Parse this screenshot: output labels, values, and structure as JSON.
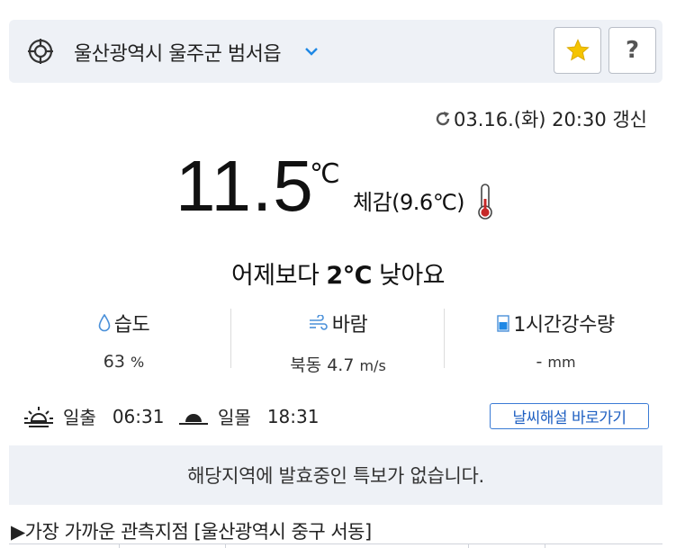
{
  "location": {
    "name": "울산광역시 울주군 범서읍",
    "locate_icon": "crosshair-icon",
    "dropdown_icon": "chevron-down-icon",
    "favorite_icon": "star-icon",
    "help_label": "?"
  },
  "update": {
    "text": "03.16.(화) 20:30 갱신",
    "icon": "refresh-icon"
  },
  "current": {
    "temperature": "11.5",
    "unit": "℃",
    "feels_like": "체감(9.6℃)",
    "thermometer_icon": "thermometer-icon"
  },
  "comparison": {
    "prefix": "어제보다 ",
    "value": "2℃",
    "suffix": " 낮아요"
  },
  "stats": {
    "humidity": {
      "label": "습도",
      "value": "63",
      "unit": "%",
      "icon": "droplet-icon"
    },
    "wind": {
      "label": "바람",
      "value": "북동 4.7",
      "unit": "m/s",
      "icon": "wind-icon"
    },
    "rain": {
      "label": "1시간강수량",
      "value": "-",
      "unit": "mm",
      "icon": "rain-gauge-icon"
    }
  },
  "sun": {
    "sunrise_label": "일출",
    "sunrise_time": "06:31",
    "sunset_label": "일몰",
    "sunset_time": "18:31"
  },
  "commentary_button": "날씨해설 바로가기",
  "alert_text": "해당지역에 발효중인 특보가 없습니다.",
  "nearest_station": "▶가장 가까운 관측지점 [울산광역시 중구 서동]",
  "colors": {
    "panel_bg": "#eef1f6",
    "accent_blue": "#1e5fc2",
    "star": "#f5c400",
    "thermo_red": "#c62828"
  }
}
